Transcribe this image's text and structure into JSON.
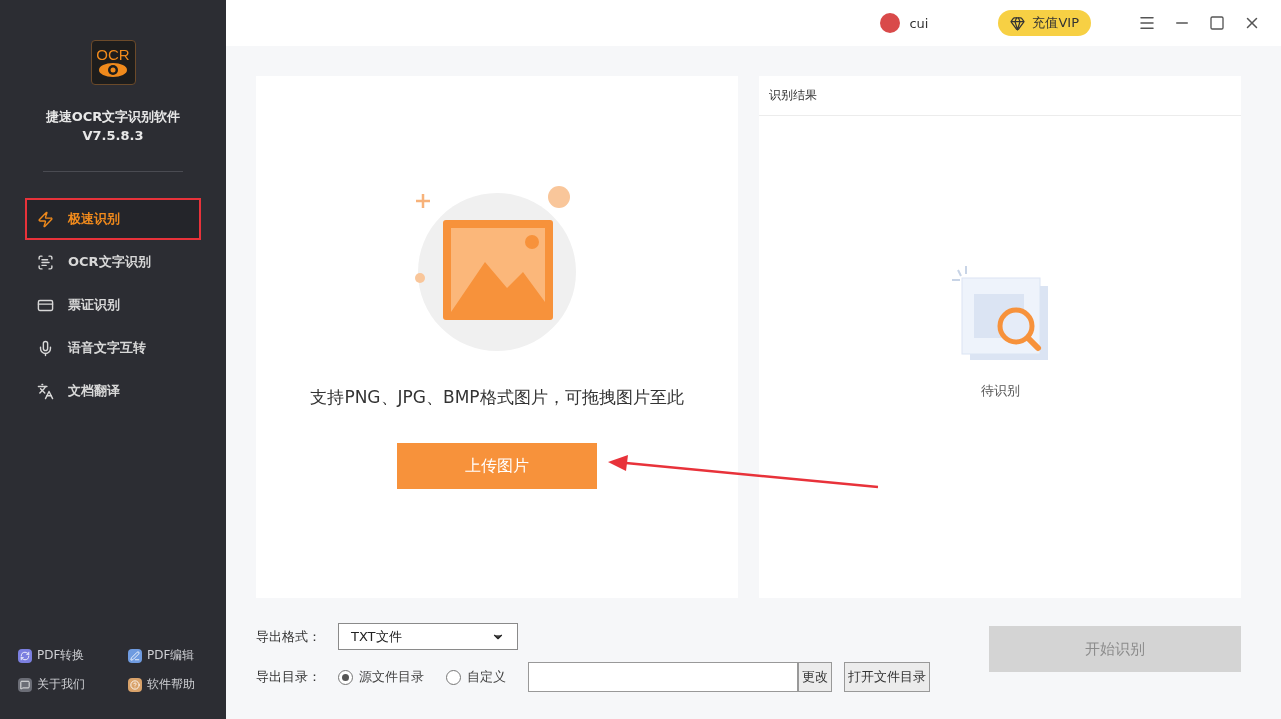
{
  "app": {
    "logo_text": "OCR",
    "name": "捷速OCR文字识别软件",
    "version": "V7.5.8.3"
  },
  "nav": [
    {
      "label": "极速识别",
      "selected": true
    },
    {
      "label": "OCR文字识别",
      "selected": false
    },
    {
      "label": "票证识别",
      "selected": false
    },
    {
      "label": "语音文字互转",
      "selected": false
    },
    {
      "label": "文档翻译",
      "selected": false
    }
  ],
  "footer_links": [
    {
      "label": "PDF转换",
      "color": "#7b7fe0"
    },
    {
      "label": "PDF编辑",
      "color": "#6f9be0"
    },
    {
      "label": "关于我们",
      "color": "#6b6d76"
    },
    {
      "label": "软件帮助",
      "color": "#d9a26a"
    }
  ],
  "user": {
    "name": "cui"
  },
  "vip": "充值VIP",
  "upload": {
    "hint": "支持PNG、JPG、BMP格式图片，可拖拽图片至此",
    "button": "上传图片"
  },
  "result": {
    "title": "识别结果",
    "status": "待识别"
  },
  "export": {
    "format_label": "导出格式：",
    "format": "TXT文件",
    "dir_label": "导出目录：",
    "options": [
      {
        "label": "源文件目录",
        "selected": true
      },
      {
        "label": "自定义",
        "selected": false
      }
    ],
    "change": "更改",
    "open": "打开文件目录"
  },
  "start": {
    "label": "开始识别",
    "disabled": true
  }
}
